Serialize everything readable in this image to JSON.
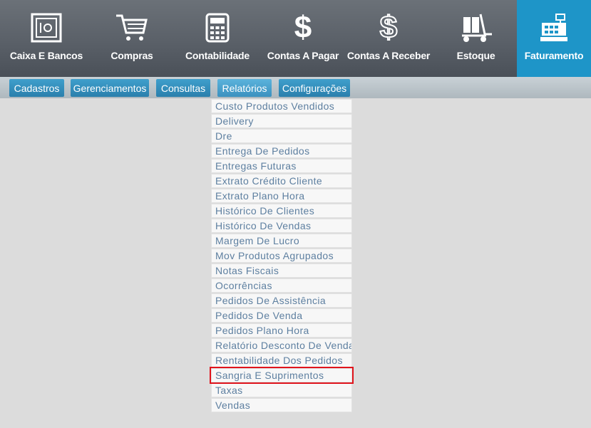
{
  "modules": [
    {
      "key": "caixa",
      "label": "Caixa E Bancos",
      "icon": "safe-icon"
    },
    {
      "key": "compras",
      "label": "Compras",
      "icon": "shopping-cart-icon"
    },
    {
      "key": "contabilidade",
      "label": "Contabilidade",
      "icon": "calculator-icon"
    },
    {
      "key": "pagar",
      "label": "Contas A Pagar",
      "icon": "dollar-icon"
    },
    {
      "key": "receber",
      "label": "Contas A Receber",
      "icon": "dollar-outline-icon"
    },
    {
      "key": "estoque",
      "label": "Estoque",
      "icon": "hand-truck-icon"
    },
    {
      "key": "faturamento",
      "label": "Faturamento",
      "icon": "cash-register-icon",
      "active": true
    }
  ],
  "subtabs": [
    "Cadastros",
    "Gerenciamentos",
    "Consultas",
    "Relatórios",
    "Configurações"
  ],
  "active_subtab": "Relatórios",
  "dropdown_items": [
    "Custo Produtos Vendidos",
    "Delivery",
    "Dre",
    "Entrega De Pedidos",
    "Entregas Futuras",
    "Extrato Crédito Cliente",
    "Extrato Plano Hora",
    "Histórico De Clientes",
    "Histórico De Vendas",
    "Margem De Lucro",
    "Mov Produtos Agrupados",
    "Notas Fiscais",
    "Ocorrências",
    "Pedidos De Assistência",
    "Pedidos De Venda",
    "Pedidos Plano Hora",
    "Relatório Desconto De Vendas",
    "Rentabilidade Dos Pedidos",
    "Sangria E Suprimentos",
    "Taxas",
    "Vendas"
  ],
  "highlighted_item": "Sangria E Suprimentos",
  "colors": {
    "active_module": "#1e95c8",
    "highlight": "#e0141c",
    "item_text": "#5d7fa0"
  }
}
